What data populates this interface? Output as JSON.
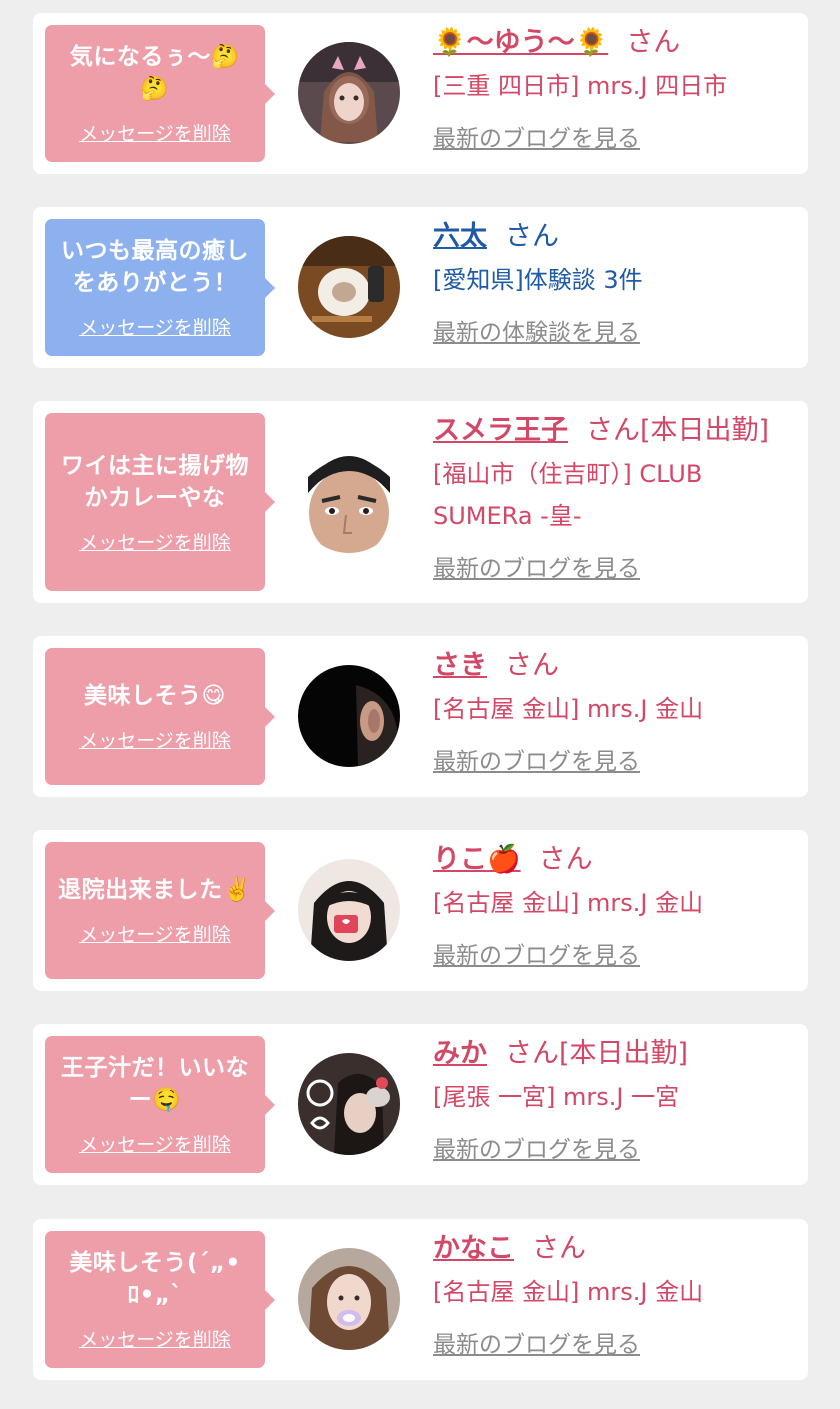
{
  "delete_label": "メッセージを削除",
  "colors": {
    "pink_bubble": "#ed9ea9",
    "blue_bubble": "#8db0ee",
    "pink_text": "#d24866",
    "blue_text": "#1f5aa6",
    "link_gray": "#8c8c8c"
  },
  "cards": [
    {
      "message_lines": [
        "気になるぅ〜🤔",
        "🤔"
      ],
      "name": "🌻〜ゆう〜🌻",
      "suffix": "さん",
      "shop_lines": [
        "[三重 四日市] mrs.J 四日市"
      ],
      "link": "最新のブログを見る",
      "theme": "pink"
    },
    {
      "message_lines": [
        "いつも最高の癒し",
        "をありがとう！"
      ],
      "name": "六太",
      "suffix": "さん",
      "shop_lines": [
        "[愛知県]体験談 3件"
      ],
      "link": "最新の体験談を見る",
      "theme": "blue"
    },
    {
      "message_lines": [
        "ワイは主に揚げ物",
        "かカレーやな"
      ],
      "name": "スメラ王子",
      "suffix": "さん[本日出勤]",
      "shop_lines": [
        "[福山市（住吉町）] CLUB",
        "SUMERa -皇-"
      ],
      "link": "最新のブログを見る",
      "theme": "pink"
    },
    {
      "message_lines": [
        "美味しそう😋"
      ],
      "name": "さき",
      "suffix": "さん",
      "shop_lines": [
        "[名古屋 金山] mrs.J 金山"
      ],
      "link": "最新のブログを見る",
      "theme": "pink"
    },
    {
      "message_lines": [
        "退院出来ました✌️"
      ],
      "name": "りこ🍎",
      "suffix": "さん",
      "shop_lines": [
        "[名古屋 金山] mrs.J 金山"
      ],
      "link": "最新のブログを見る",
      "theme": "pink"
    },
    {
      "message_lines": [
        "王子汁だ！いいな",
        "ー🤤"
      ],
      "name": "みか",
      "suffix": "さん[本日出勤]",
      "shop_lines": [
        "[尾張 一宮] mrs.J 一宮"
      ],
      "link": "最新のブログを見る",
      "theme": "pink"
    },
    {
      "message_lines": [
        "美味しそう(´„•",
        "ﾛ•„`"
      ],
      "name": "かなこ",
      "suffix": "さん",
      "shop_lines": [
        "[名古屋 金山] mrs.J 金山"
      ],
      "link": "最新のブログを見る",
      "theme": "pink"
    }
  ]
}
